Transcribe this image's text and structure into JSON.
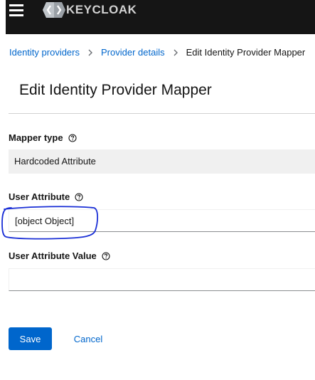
{
  "header": {
    "logo_text": "KEYCLOAK",
    "menu_icon": "hamburger-icon",
    "logo_icon": "keycloak-logo-icon"
  },
  "breadcrumb": {
    "items": [
      "Identity providers",
      "Provider details"
    ],
    "current": "Edit Identity Provider Mapper",
    "separator_icon": "chevron-right-icon"
  },
  "page": {
    "title": "Edit Identity Provider Mapper"
  },
  "form": {
    "mapper_type": {
      "label": "Mapper type",
      "value": "Hardcoded Attribute",
      "help_icon": "help-circle-icon"
    },
    "user_attribute": {
      "label": "User Attribute",
      "value": "[object Object]",
      "help_icon": "help-circle-icon"
    },
    "user_attribute_value": {
      "label": "User Attribute Value",
      "value": "",
      "help_icon": "help-circle-icon"
    }
  },
  "actions": {
    "save_label": "Save",
    "cancel_label": "Cancel"
  },
  "colors": {
    "topbar_bg": "#151515",
    "link": "#0066cc",
    "primary_button": "#0066cc",
    "annotation_ink": "#1a2fd6",
    "readonly_bg": "#f0f0f0"
  }
}
